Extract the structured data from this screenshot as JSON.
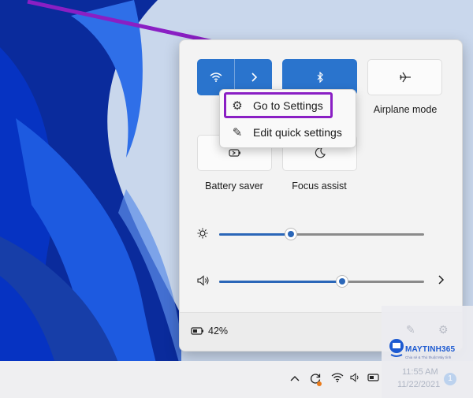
{
  "quick_settings": {
    "tiles": [
      {
        "id": "wifi",
        "icon": "wifi-icon",
        "state": "on"
      },
      {
        "id": "bluetooth",
        "icon": "bluetooth-icon",
        "state": "on"
      },
      {
        "id": "airplane",
        "icon": "airplane-icon",
        "label": "Airplane mode",
        "state": "off"
      },
      {
        "id": "battery_saver",
        "icon": "battery-saver-icon",
        "label": "Battery saver",
        "state": "off"
      },
      {
        "id": "focus_assist",
        "icon": "moon-icon",
        "label": "Focus assist",
        "state": "off"
      }
    ],
    "brightness": {
      "level": 0.35,
      "icon": "sun-icon"
    },
    "volume": {
      "level": 0.6,
      "icon": "speaker-icon"
    },
    "battery_percent": "42%"
  },
  "context_menu": {
    "items": [
      {
        "label": "Go to Settings",
        "icon": "gear-icon"
      },
      {
        "label": "Edit quick settings",
        "icon": "pencil-icon"
      }
    ]
  },
  "watermark": {
    "brand": "MAYTINH365",
    "tagline": "Chia sẻ & Thủ thuật Máy tính",
    "time": "11:55 AM",
    "date": "11/22/2021",
    "badge": "1"
  },
  "colors": {
    "accent": "#2a74cd",
    "highlight": "#8a1fc4",
    "arrow": "#8a1fc4"
  }
}
